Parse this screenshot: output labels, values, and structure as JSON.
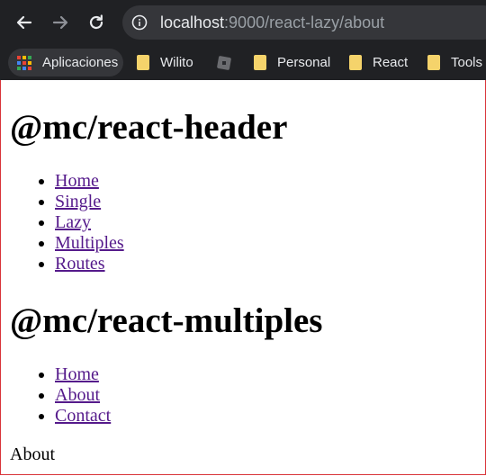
{
  "browser": {
    "url_host": "localhost",
    "url_path": ":9000/react-lazy/about",
    "bookmarks": [
      {
        "label": "Aplicaciones",
        "icon": "apps-grid-icon"
      },
      {
        "label": "Wilito",
        "icon": "folder-icon"
      },
      {
        "label": "",
        "icon": "site-favicon-icon"
      },
      {
        "label": "Personal",
        "icon": "folder-icon"
      },
      {
        "label": "React",
        "icon": "folder-icon"
      },
      {
        "label": "Tools",
        "icon": "folder-icon"
      }
    ]
  },
  "header": {
    "title": "@mc/react-header",
    "links": [
      "Home",
      "Single",
      "Lazy",
      "Multiples",
      "Routes"
    ]
  },
  "multiples": {
    "title": "@mc/react-multiples",
    "links": [
      "Home",
      "About",
      "Contact"
    ]
  },
  "content": {
    "text": "About"
  },
  "colors": {
    "link": "#551a8b",
    "chrome": "#202124",
    "omnibox": "#35363a",
    "frame_border": "#d9343a"
  }
}
